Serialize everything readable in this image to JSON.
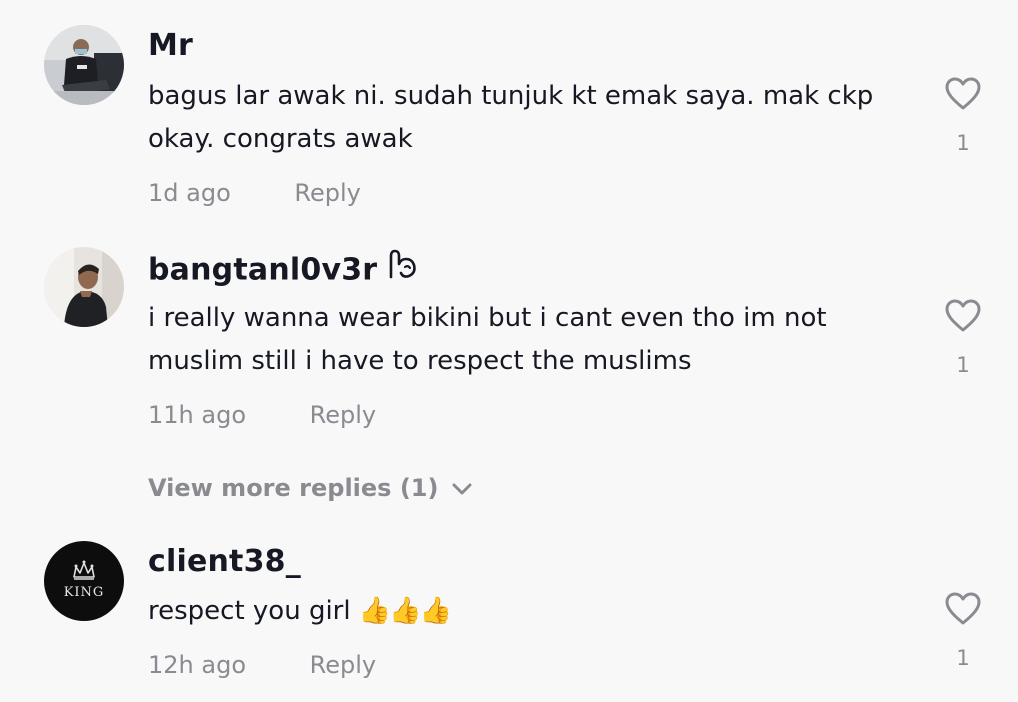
{
  "comments": [
    {
      "username": "Mr",
      "text": "bagus lar awak ni. sudah tunjuk kt emak saya. mak ckp okay. congrats awak",
      "time": "1d ago",
      "reply_label": "Reply",
      "likes": "1",
      "avatar_icon": "person-at-desk-photo"
    },
    {
      "username": "bangtanl0v3r",
      "badge_icon": "hand-gesture-emoji",
      "text": "i really wanna wear bikini but i cant even tho im not muslim still i have to respect the muslims",
      "time": "11h ago",
      "reply_label": "Reply",
      "likes": "1",
      "avatar_icon": "person-portrait-photo"
    },
    {
      "username": "client38_",
      "text": "respect you girl",
      "emoji": "👍👍👍",
      "time": "12h ago",
      "reply_label": "Reply",
      "likes": "1",
      "avatar_icon": "king-crown-logo",
      "avatar_text": "KING"
    }
  ],
  "view_more": "View more replies (1)",
  "colors": {
    "background": "#f8f8f8",
    "text": "#161823",
    "secondary": "#8a8b91"
  }
}
